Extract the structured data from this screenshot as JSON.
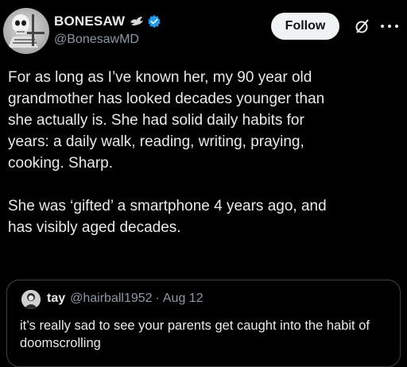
{
  "author": {
    "display_name": "BONESAW",
    "handle": "@BonesawMD",
    "verified": true,
    "badge_icon": "bird-icon"
  },
  "actions": {
    "follow_label": "Follow",
    "grok_icon": "grok-icon",
    "more_icon": "more-icon"
  },
  "tweet": {
    "text": "For as long as I’ve known her, my 90 year old\ngrandmother has looked decades younger than\nshe actually is. She had solid daily habits for\nyears: a daily walk, reading, writing, praying,\ncooking. Sharp.\n\nShe was ‘gifted’ a smartphone 4 years ago, and\nhas visibly aged decades."
  },
  "quote": {
    "name": "tay",
    "handle": "@hairball1952",
    "separator": "·",
    "date": "Aug 12",
    "text": "it’s really sad to see your parents get caught into the habit of doomscrolling"
  },
  "colors": {
    "background": "#000000",
    "text": "#e7e9ea",
    "secondary": "#8b98a5",
    "verified": "#1d9bf0",
    "border": "#3e4144"
  }
}
